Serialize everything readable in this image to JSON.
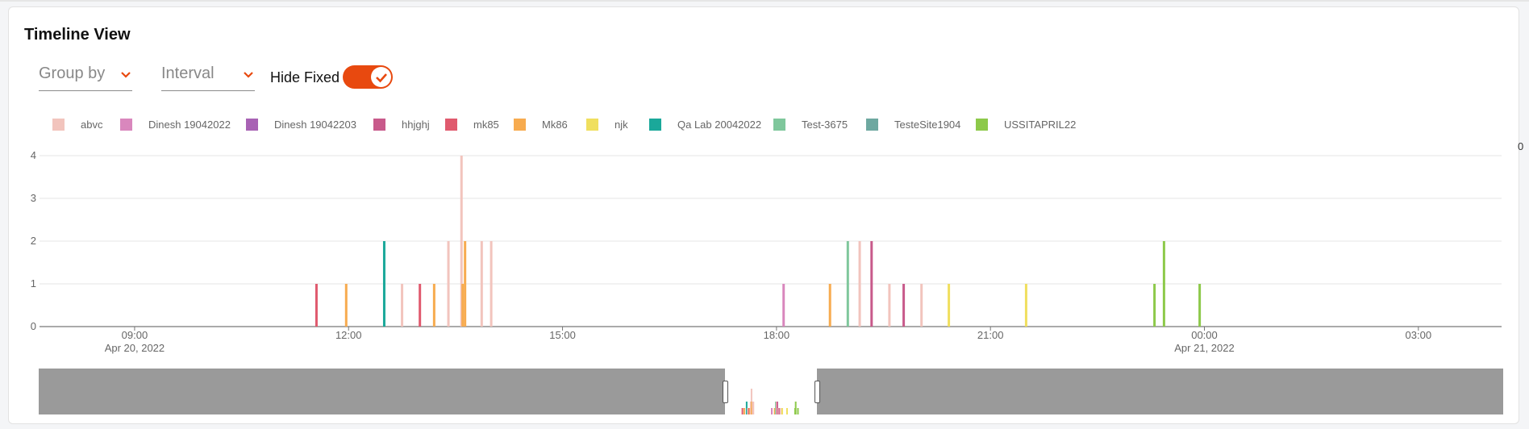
{
  "panel": {
    "title": "Timeline View",
    "group_by": "Group by",
    "interval": "Interval",
    "hide_fixed_label": "Hide Fixed",
    "hide_fixed_on": true,
    "accent_color": "#e8490f",
    "clipped_right_text": "0"
  },
  "legend": [
    {
      "name": "abvc",
      "color": "#f2c4bd"
    },
    {
      "name": "Dinesh 19042022",
      "color": "#d987bd"
    },
    {
      "name": "Dinesh 19042203",
      "color": "#a862b4"
    },
    {
      "name": "hhjghj",
      "color": "#c85a8b"
    },
    {
      "name": "mk85",
      "color": "#e05a6e"
    },
    {
      "name": "Mk86",
      "color": "#f7ab4f"
    },
    {
      "name": "njk",
      "color": "#f0df5e"
    },
    {
      "name": "Qa Lab 20042022",
      "color": "#1aa89a"
    },
    {
      "name": "Test-3675",
      "color": "#7fc79c"
    },
    {
      "name": "TesteSite1904",
      "color": "#6ea8a0"
    },
    {
      "name": "USSITAPRIL22",
      "color": "#8dc94a"
    }
  ],
  "chart_data": {
    "type": "bar",
    "y_ticks": [
      "0",
      "1",
      "2",
      "3",
      "4"
    ],
    "ylim": [
      0,
      4
    ],
    "xlim": [
      "2022-04-20 07:40",
      "2022-04-21 04:10"
    ],
    "x_ticks": [
      {
        "time": "09:00",
        "date": "Apr 20, 2022"
      },
      {
        "time": "12:00",
        "date": ""
      },
      {
        "time": "15:00",
        "date": ""
      },
      {
        "time": "18:00",
        "date": ""
      },
      {
        "time": "21:00",
        "date": ""
      },
      {
        "time": "00:00",
        "date": "Apr 21, 2022"
      },
      {
        "time": "03:00",
        "date": ""
      }
    ],
    "grid": true,
    "points": [
      {
        "series": "mk85",
        "time": "2022-04-20 11:33",
        "value": 1
      },
      {
        "series": "Mk86",
        "time": "2022-04-20 11:58",
        "value": 1
      },
      {
        "series": "Qa Lab 20042022",
        "time": "2022-04-20 12:30",
        "value": 2
      },
      {
        "series": "abvc",
        "time": "2022-04-20 12:45",
        "value": 1
      },
      {
        "series": "mk85",
        "time": "2022-04-20 13:00",
        "value": 1
      },
      {
        "series": "Mk86",
        "time": "2022-04-20 13:12",
        "value": 1
      },
      {
        "series": "abvc",
        "time": "2022-04-20 13:24",
        "value": 2
      },
      {
        "series": "abvc",
        "time": "2022-04-20 13:35",
        "value": 4
      },
      {
        "series": "Mk86",
        "time": "2022-04-20 13:36",
        "value": 1
      },
      {
        "series": "Mk86",
        "time": "2022-04-20 13:38",
        "value": 2
      },
      {
        "series": "abvc",
        "time": "2022-04-20 13:52",
        "value": 2
      },
      {
        "series": "abvc",
        "time": "2022-04-20 14:00",
        "value": 2
      },
      {
        "series": "Dinesh 19042022",
        "time": "2022-04-20 18:06",
        "value": 1
      },
      {
        "series": "Mk86",
        "time": "2022-04-20 18:45",
        "value": 1
      },
      {
        "series": "Test-3675",
        "time": "2022-04-20 19:00",
        "value": 2
      },
      {
        "series": "abvc",
        "time": "2022-04-20 19:10",
        "value": 2
      },
      {
        "series": "hhjghj",
        "time": "2022-04-20 19:20",
        "value": 2
      },
      {
        "series": "abvc",
        "time": "2022-04-20 19:35",
        "value": 1
      },
      {
        "series": "hhjghj",
        "time": "2022-04-20 19:47",
        "value": 1
      },
      {
        "series": "abvc",
        "time": "2022-04-20 20:02",
        "value": 1
      },
      {
        "series": "njk",
        "time": "2022-04-20 20:25",
        "value": 1
      },
      {
        "series": "njk",
        "time": "2022-04-20 21:30",
        "value": 1
      },
      {
        "series": "USSITAPRIL22",
        "time": "2022-04-20 23:18",
        "value": 1
      },
      {
        "series": "USSITAPRIL22",
        "time": "2022-04-20 23:26",
        "value": 2
      },
      {
        "series": "USSITAPRIL22",
        "time": "2022-04-20 23:56",
        "value": 1
      }
    ]
  },
  "navigator": {
    "window_start": "2022-04-20 07:40",
    "window_end": "2022-04-21 04:10",
    "overview_start": "2022-04-16 00:00",
    "overview_end": "2022-04-30 00:00"
  }
}
